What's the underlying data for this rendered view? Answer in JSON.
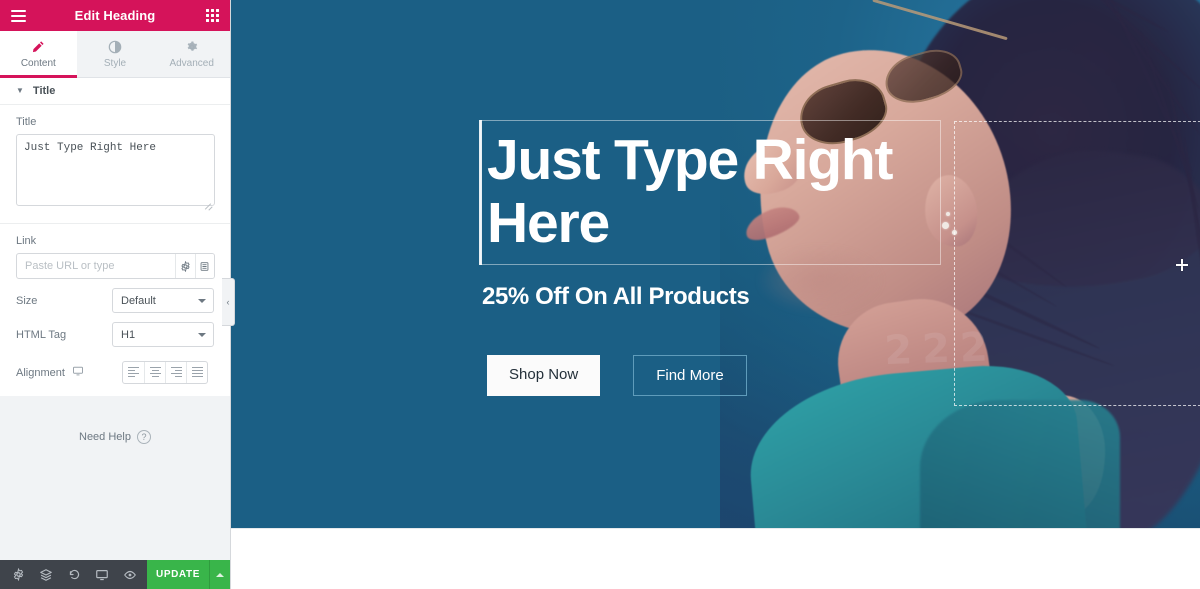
{
  "panel": {
    "header": {
      "title": "Edit Heading",
      "menu_icon": "hamburger-icon",
      "widgets_icon": "grid-icon"
    },
    "tabs": [
      {
        "label": "Content",
        "icon": "pencil-icon",
        "active": true
      },
      {
        "label": "Style",
        "icon": "half-circle-icon",
        "active": false
      },
      {
        "label": "Advanced",
        "icon": "gear-icon",
        "active": false
      }
    ],
    "section": {
      "label": "Title",
      "chevron": "chevron-down-icon"
    },
    "controls": {
      "title": {
        "label": "Title",
        "value": "Just Type Right Here"
      },
      "link": {
        "label": "Link",
        "value": "",
        "placeholder": "Paste URL or type",
        "options_icon": "gear-icon",
        "dynamic_icon": "database-icon"
      },
      "size": {
        "label": "Size",
        "value": "Default"
      },
      "html_tag": {
        "label": "HTML Tag",
        "value": "H1"
      },
      "alignment": {
        "label": "Alignment",
        "device_icon": "desktop-icon",
        "options": [
          "align-left-icon",
          "align-center-icon",
          "align-right-icon",
          "align-justify-icon"
        ]
      }
    },
    "need_help": {
      "label": "Need Help",
      "icon": "question-circle-icon"
    },
    "footer": {
      "icons": [
        "settings-gear-icon",
        "navigator-layers-icon",
        "history-clock-icon",
        "responsive-monitor-icon",
        "preview-eye-icon"
      ],
      "update_label": "UPDATE",
      "update_caret_icon": "caret-up-icon"
    }
  },
  "canvas": {
    "collapse_handle_icon": "chevron-left-icon",
    "heading": "Just Type Right Here",
    "subheading": "25% Off On All Products",
    "buttons": [
      {
        "label": "Shop Now",
        "style": "solid"
      },
      {
        "label": "Find More",
        "style": "ghost"
      }
    ],
    "image_widget": {
      "alt": "woman-in-profile-with-sunglasses",
      "cursor_icon": "plus-cursor-icon"
    },
    "watermark_text": "2 2 2"
  },
  "colors": {
    "brand_pink": "#d5135a",
    "stage_blue": "#1b5f85",
    "update_green": "#39b54a",
    "footer_dark": "#3f444b",
    "panel_gray": "#f1f3f5"
  }
}
